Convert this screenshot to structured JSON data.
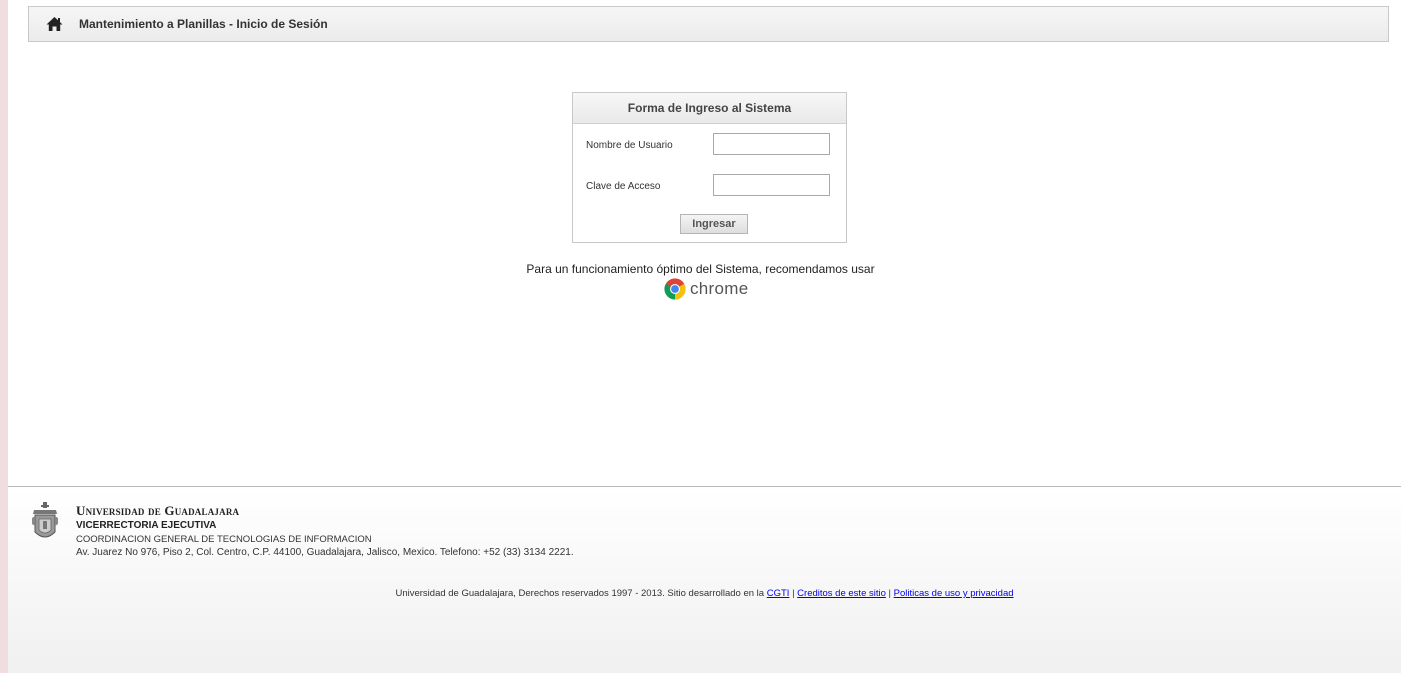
{
  "header": {
    "icon": "home-icon",
    "title": "Mantenimiento a Planillas - Inicio de Sesión"
  },
  "login": {
    "title": "Forma de Ingreso al Sistema",
    "username_label": "Nombre de Usuario",
    "username_value": "",
    "password_label": "Clave de Acceso",
    "password_value": "",
    "submit_label": "Ingresar"
  },
  "recommendation": {
    "text": "Para un funcionamiento óptimo del Sistema, recomendamos usar",
    "browser_icon": "chrome-logo-icon",
    "browser_name": "chrome"
  },
  "footer": {
    "seal_icon": "university-seal-icon",
    "university": "Universidad de Guadalajara",
    "vice": "VICERRECTORIA EJECUTIVA",
    "coordination": "COORDINACION GENERAL DE TECNOLOGIAS DE INFORMACION",
    "address": "Av. Juarez No 976, Piso 2, Col. Centro, C.P. 44100, Guadalajara, Jalisco, Mexico. Telefono: +52 (33) 3134 2221.",
    "copyright_text": "Universidad de Guadalajara, Derechos reservados 1997 - 2013. Sitio desarrollado en la",
    "link_cgti": "CGTI",
    "separator": "|",
    "link_credits": "Creditos de este sitio",
    "link_policies": "Politicas de uso y privacidad"
  },
  "colors": {
    "outer_background": "#f0dde0",
    "link": "#0000ee"
  }
}
